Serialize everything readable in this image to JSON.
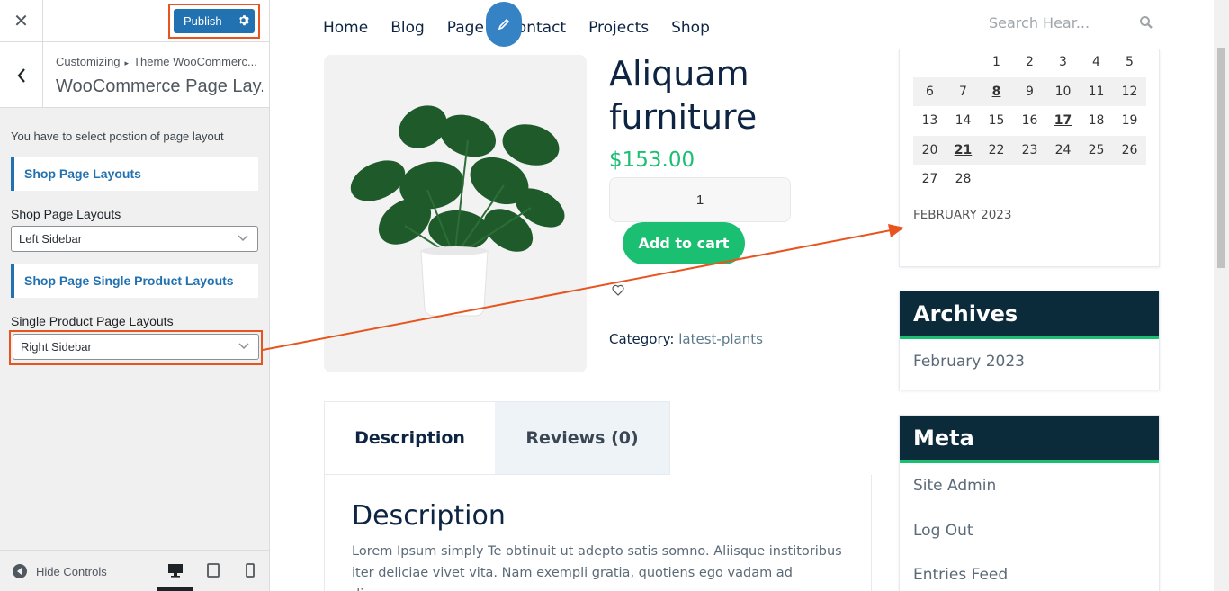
{
  "customizer": {
    "close_icon": "close-icon",
    "publish_label": "Publish",
    "breadcrumb_root": "Customizing",
    "breadcrumb_panel": "Theme WooCommerc...",
    "section_title": "WooCommerce Page Lay...",
    "instructions": "You have to select postion of page layout",
    "shop_heading": "Shop Page Layouts",
    "shop_label": "Shop Page Layouts",
    "shop_value": "Left Sidebar",
    "single_heading": "Shop Page Single Product Layouts",
    "single_label": "Single Product Page Layouts",
    "single_value": "Right Sidebar",
    "hide_controls": "Hide Controls"
  },
  "site": {
    "nav": [
      "Home",
      "Blog",
      "Page",
      "Contact",
      "Projects",
      "Shop"
    ],
    "search_placeholder": "Search Hear...",
    "product": {
      "title_line1": "Aliquam",
      "title_line2": "furniture",
      "price": "$153.00",
      "quantity": "1",
      "add_to_cart": "Add to cart",
      "category_label": "Category:",
      "category_value": "latest-plants"
    },
    "tabs": [
      "Description",
      "Reviews (0)"
    ],
    "description_heading": "Description",
    "description_text": "Lorem Ipsum simply Te obtinuit ut adepto satis somno. Aliisque institoribus iter deliciae vivet vita. Nam exempli gratia, quotiens ego vadam ad diversorum"
  },
  "calendar": {
    "rows": [
      [
        "",
        "",
        "1",
        "2",
        "3",
        "4",
        "5"
      ],
      [
        "6",
        "7",
        "8",
        "9",
        "10",
        "11",
        "12"
      ],
      [
        "13",
        "14",
        "15",
        "16",
        "17",
        "18",
        "19"
      ],
      [
        "20",
        "21",
        "22",
        "23",
        "24",
        "25",
        "26"
      ],
      [
        "27",
        "28",
        "",
        "",
        "",
        "",
        ""
      ]
    ],
    "linked_days": [
      "8",
      "17",
      "21"
    ],
    "month": "FEBRUARY 2023"
  },
  "archives": {
    "title": "Archives",
    "items": [
      "February 2023"
    ]
  },
  "meta": {
    "title": "Meta",
    "items": [
      "Site Admin",
      "Log Out",
      "Entries Feed"
    ]
  },
  "colors": {
    "accent_blue": "#2271b1",
    "highlight_orange": "#e8541e",
    "brand_green": "#1bbf72",
    "widget_dark": "#0b2a3a"
  }
}
